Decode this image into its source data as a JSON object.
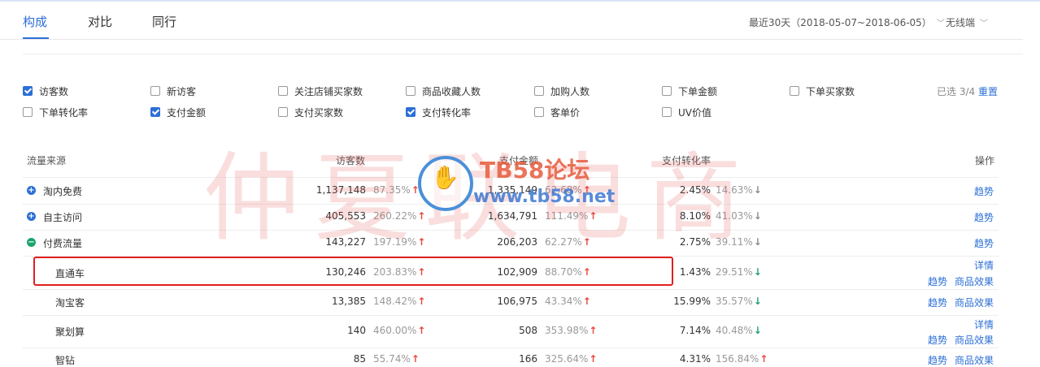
{
  "tabs": [
    {
      "label": "构成",
      "active": true
    },
    {
      "label": "对比",
      "active": false
    },
    {
      "label": "同行",
      "active": false
    }
  ],
  "date_range": "最近30天（2018-05-07~2018-06-05）",
  "device": "无线端",
  "metrics": [
    {
      "label": "访客数",
      "checked": true
    },
    {
      "label": "新访客",
      "checked": false
    },
    {
      "label": "关注店铺买家数",
      "checked": false
    },
    {
      "label": "商品收藏人数",
      "checked": false
    },
    {
      "label": "加购人数",
      "checked": false
    },
    {
      "label": "下单金额",
      "checked": false
    },
    {
      "label": "下单买家数",
      "checked": false
    },
    {
      "label": "下单转化率",
      "checked": false
    },
    {
      "label": "支付金额",
      "checked": true
    },
    {
      "label": "支付买家数",
      "checked": false
    },
    {
      "label": "支付转化率",
      "checked": true
    },
    {
      "label": "客单价",
      "checked": false
    },
    {
      "label": "UV价值",
      "checked": false
    }
  ],
  "selected_count": "已选 3/4",
  "reset_label": "重置",
  "table": {
    "headers": {
      "source": "流量来源",
      "visitors": "访客数",
      "payment": "支付金额",
      "conversion": "支付转化率",
      "actions": "操作"
    },
    "rows": [
      {
        "source": "淘内免费",
        "expand": "plus",
        "visitors": "1,137,148",
        "visitors_pct": "87.35%",
        "visitors_dir": "up",
        "payment": "1,335,149",
        "payment_pct": "62.68%",
        "payment_dir": "up",
        "conversion": "2.45%",
        "conversion_pct": "14.63%",
        "conversion_dir": "down-gray",
        "links": [
          "趋势"
        ]
      },
      {
        "source": "自主访问",
        "expand": "plus",
        "visitors": "405,553",
        "visitors_pct": "260.22%",
        "visitors_dir": "up",
        "payment": "1,634,791",
        "payment_pct": "111.49%",
        "payment_dir": "up",
        "conversion": "8.10%",
        "conversion_pct": "41.03%",
        "conversion_dir": "down-gray",
        "links": [
          "趋势"
        ]
      },
      {
        "source": "付费流量",
        "expand": "minus",
        "visitors": "143,227",
        "visitors_pct": "197.19%",
        "visitors_dir": "up",
        "payment": "206,203",
        "payment_pct": "62.27%",
        "payment_dir": "up",
        "conversion": "2.75%",
        "conversion_pct": "39.11%",
        "conversion_dir": "down-gray",
        "links": [
          "趋势"
        ]
      },
      {
        "source": "直通车",
        "expand": "",
        "visitors": "130,246",
        "visitors_pct": "203.83%",
        "visitors_dir": "up",
        "payment": "102,909",
        "payment_pct": "88.70%",
        "payment_dir": "up",
        "conversion": "1.43%",
        "conversion_pct": "29.51%",
        "conversion_dir": "down-green",
        "links": [
          "详情",
          "趋势",
          "商品效果"
        ]
      },
      {
        "source": "淘宝客",
        "expand": "",
        "visitors": "13,385",
        "visitors_pct": "148.42%",
        "visitors_dir": "up",
        "payment": "106,975",
        "payment_pct": "43.34%",
        "payment_dir": "up",
        "conversion": "15.99%",
        "conversion_pct": "35.57%",
        "conversion_dir": "down-green",
        "links": [
          "趋势",
          "商品效果"
        ]
      },
      {
        "source": "聚划算",
        "expand": "",
        "visitors": "140",
        "visitors_pct": "460.00%",
        "visitors_dir": "up",
        "payment": "508",
        "payment_pct": "353.98%",
        "payment_dir": "up",
        "conversion": "7.14%",
        "conversion_pct": "40.48%",
        "conversion_dir": "down-green",
        "links": [
          "详情",
          "趋势",
          "商品效果"
        ]
      },
      {
        "source": "智钻",
        "expand": "",
        "visitors": "85",
        "visitors_pct": "55.74%",
        "visitors_dir": "up",
        "payment": "166",
        "payment_pct": "325.64%",
        "payment_dir": "up",
        "conversion": "4.31%",
        "conversion_pct": "156.84%",
        "conversion_dir": "up",
        "links": [
          "趋势",
          "商品效果"
        ]
      }
    ]
  },
  "watermark": {
    "big_text": "仲夏联电商",
    "brand": "TB58论坛",
    "url": "www.tb58.net"
  },
  "colors": {
    "accent": "#2c6fd6",
    "up": "#e8463d",
    "down": "#1aa36b",
    "highlight": "#e12020"
  }
}
